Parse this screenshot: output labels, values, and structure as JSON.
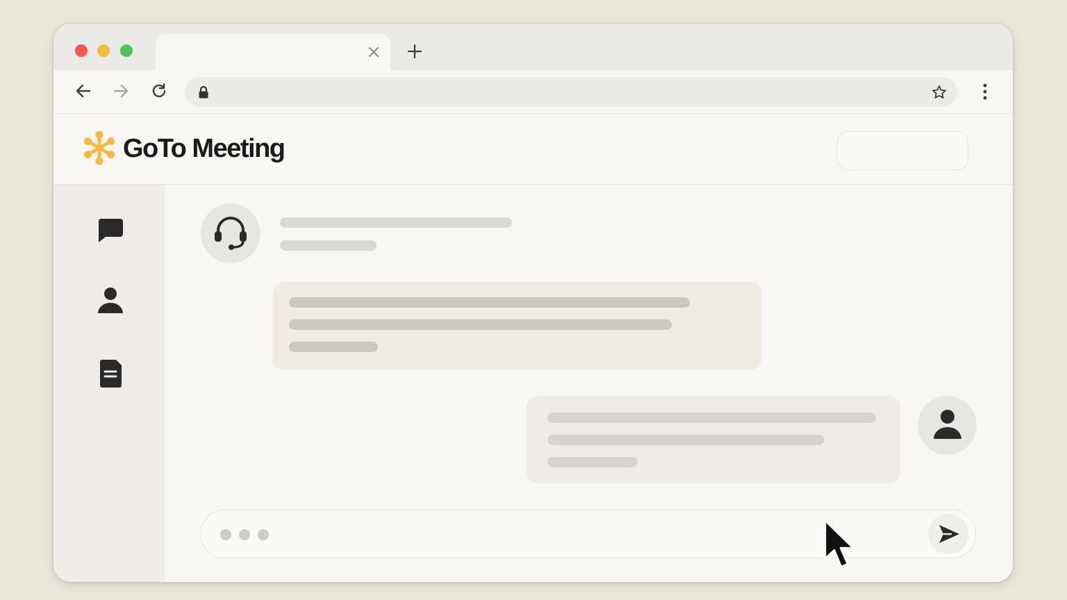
{
  "app": {
    "brand_name": "GoTo Meeting",
    "brand_color": "#f5b942",
    "text_color": "#1b1b1b"
  },
  "browser": {
    "tab_title": "",
    "address": "",
    "traffic_lights": [
      "#f05a4f",
      "#f5bd3d",
      "#4fc25a"
    ],
    "icons": {
      "back": "arrow-left-icon",
      "forward": "arrow-right-icon",
      "reload": "reload-icon",
      "lock": "lock-icon",
      "bookmark": "star-icon",
      "menu": "kebab-menu-icon",
      "close_tab": "close-icon",
      "new_tab": "plus-icon"
    }
  },
  "header": {
    "action_button_label": ""
  },
  "sidebar": {
    "items": [
      {
        "icon": "chat-bubble-icon",
        "label": ""
      },
      {
        "icon": "person-icon",
        "label": ""
      },
      {
        "icon": "document-icon",
        "label": ""
      }
    ]
  },
  "chat": {
    "agent_avatar_icon": "headset-icon",
    "user_avatar_icon": "person-icon",
    "messages": [
      {
        "sender": "agent",
        "text": ""
      },
      {
        "sender": "user",
        "text": ""
      }
    ],
    "composer": {
      "value": "",
      "typing_indicator": true,
      "send_icon": "send-icon"
    }
  },
  "cursor": {
    "icon": "mouse-pointer-icon"
  }
}
